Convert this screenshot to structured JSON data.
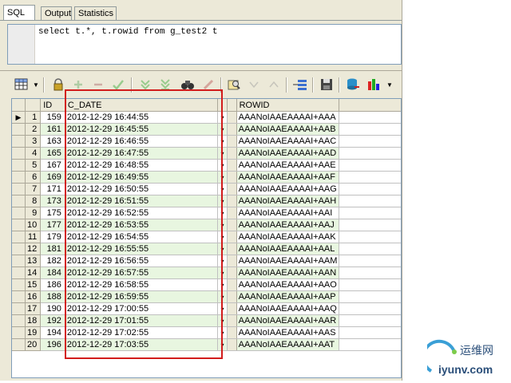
{
  "tabs": [
    {
      "label": "SQL",
      "active": true
    },
    {
      "label": "Output",
      "active": false
    },
    {
      "label": "Statistics",
      "active": false
    }
  ],
  "editor": {
    "sql": "select t.*, t.rowid from g_test2 t"
  },
  "toolbar": {
    "icons": [
      "grid-view-icon",
      "lock-icon",
      "insert-record-icon",
      "delete-record-icon",
      "post-changes-icon",
      "next-record-icon",
      "last-record-icon",
      "find-icon",
      "clear-icon",
      "query-by-example-icon",
      "previous-icon",
      "next-icon",
      "single-record-view-icon",
      "save-icon",
      "export-icon",
      "chart-icon"
    ]
  },
  "grid": {
    "columns": {
      "id": "ID",
      "c_date": "C_DATE",
      "rowid": "ROWID"
    },
    "rows": [
      {
        "n": "1",
        "id": "159",
        "date": "2012-12-29 16:44:55",
        "rowid": "AAANoIAAEAAAAI+AAA"
      },
      {
        "n": "2",
        "id": "161",
        "date": "2012-12-29 16:45:55",
        "rowid": "AAANoIAAEAAAAI+AAB"
      },
      {
        "n": "3",
        "id": "163",
        "date": "2012-12-29 16:46:55",
        "rowid": "AAANoIAAEAAAAI+AAC"
      },
      {
        "n": "4",
        "id": "165",
        "date": "2012-12-29 16:47:55",
        "rowid": "AAANoIAAEAAAAI+AAD"
      },
      {
        "n": "5",
        "id": "167",
        "date": "2012-12-29 16:48:55",
        "rowid": "AAANoIAAEAAAAI+AAE"
      },
      {
        "n": "6",
        "id": "169",
        "date": "2012-12-29 16:49:55",
        "rowid": "AAANoIAAEAAAAI+AAF"
      },
      {
        "n": "7",
        "id": "171",
        "date": "2012-12-29 16:50:55",
        "rowid": "AAANoIAAEAAAAI+AAG"
      },
      {
        "n": "8",
        "id": "173",
        "date": "2012-12-29 16:51:55",
        "rowid": "AAANoIAAEAAAAI+AAH"
      },
      {
        "n": "9",
        "id": "175",
        "date": "2012-12-29 16:52:55",
        "rowid": "AAANoIAAEAAAAI+AAI"
      },
      {
        "n": "10",
        "id": "177",
        "date": "2012-12-29 16:53:55",
        "rowid": "AAANoIAAEAAAAI+AAJ"
      },
      {
        "n": "11",
        "id": "179",
        "date": "2012-12-29 16:54:55",
        "rowid": "AAANoIAAEAAAAI+AAK"
      },
      {
        "n": "12",
        "id": "181",
        "date": "2012-12-29 16:55:55",
        "rowid": "AAANoIAAEAAAAI+AAL"
      },
      {
        "n": "13",
        "id": "182",
        "date": "2012-12-29 16:56:55",
        "rowid": "AAANoIAAEAAAAI+AAM"
      },
      {
        "n": "14",
        "id": "184",
        "date": "2012-12-29 16:57:55",
        "rowid": "AAANoIAAEAAAAI+AAN"
      },
      {
        "n": "15",
        "id": "186",
        "date": "2012-12-29 16:58:55",
        "rowid": "AAANoIAAEAAAAI+AAO"
      },
      {
        "n": "16",
        "id": "188",
        "date": "2012-12-29 16:59:55",
        "rowid": "AAANoIAAEAAAAI+AAP"
      },
      {
        "n": "17",
        "id": "190",
        "date": "2012-12-29 17:00:55",
        "rowid": "AAANoIAAEAAAAI+AAQ"
      },
      {
        "n": "18",
        "id": "192",
        "date": "2012-12-29 17:01:55",
        "rowid": "AAANoIAAEAAAAI+AAR"
      },
      {
        "n": "19",
        "id": "194",
        "date": "2012-12-29 17:02:55",
        "rowid": "AAANoIAAEAAAAI+AAS"
      },
      {
        "n": "20",
        "id": "196",
        "date": "2012-12-29 17:03:55",
        "rowid": "AAANoIAAEAAAAI+AAT"
      }
    ],
    "current_row_marker": "▶",
    "dropdown_glyph": "▾"
  },
  "colors": {
    "highlight": "#d21c1c",
    "row_alt": "#e8f6e0"
  },
  "watermark": {
    "line1": "运维网",
    "line2": "iyunv.com"
  }
}
